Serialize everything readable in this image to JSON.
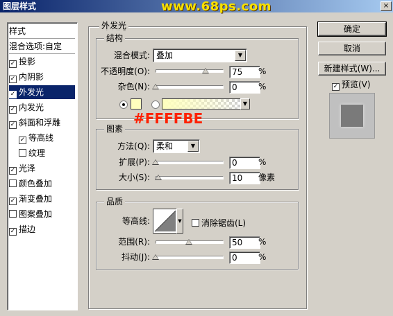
{
  "window": {
    "title": "图层样式",
    "watermark": "www.68ps.com",
    "close_label": "×"
  },
  "sidebar": {
    "header": "样式",
    "blend_options": "混合选项:自定",
    "items": [
      {
        "label": "投影",
        "checked": true
      },
      {
        "label": "内阴影",
        "checked": true
      },
      {
        "label": "外发光",
        "checked": true
      },
      {
        "label": "内发光",
        "checked": true
      },
      {
        "label": "斜面和浮雕",
        "checked": true
      },
      {
        "label": "等高线",
        "checked": true
      },
      {
        "label": "纹理",
        "checked": false
      },
      {
        "label": "光泽",
        "checked": true
      },
      {
        "label": "颜色叠加",
        "checked": false
      },
      {
        "label": "渐变叠加",
        "checked": true
      },
      {
        "label": "图案叠加",
        "checked": false
      },
      {
        "label": "描边",
        "checked": true
      }
    ],
    "selected": "外发光"
  },
  "panel": {
    "title": "外发光",
    "structure": {
      "title": "结构",
      "blend_mode_label": "混合模式:",
      "blend_mode_value": "叠加",
      "opacity_label": "不透明度(O):",
      "opacity_value": "75",
      "opacity_fraction": 0.75,
      "noise_label": "杂色(N):",
      "noise_value": "0",
      "noise_fraction": 0,
      "unit_percent": "%",
      "color_swatch": "#FFFFBE"
    },
    "elements": {
      "title": "图素",
      "method_label": "方法(Q):",
      "method_value": "柔和",
      "spread_label": "扩展(P):",
      "spread_value": "0",
      "spread_fraction": 0,
      "size_label": "大小(S):",
      "size_value": "10",
      "size_fraction": 0.04,
      "unit_percent": "%",
      "unit_pixels": "像素"
    },
    "quality": {
      "title": "品质",
      "contour_label": "等高线:",
      "anti_alias_label": "消除锯齿(L)",
      "anti_alias_checked": false,
      "range_label": "范围(R):",
      "range_value": "50",
      "range_fraction": 0.5,
      "jitter_label": "抖动(J):",
      "jitter_value": "0",
      "jitter_fraction": 0,
      "unit_percent": "%"
    }
  },
  "annotation": {
    "text": "#FFFFBE"
  },
  "buttons": {
    "ok": "确定",
    "cancel": "取消",
    "new_style": "新建样式(W)...",
    "preview_label": "预览(V)",
    "preview_checked": true
  }
}
